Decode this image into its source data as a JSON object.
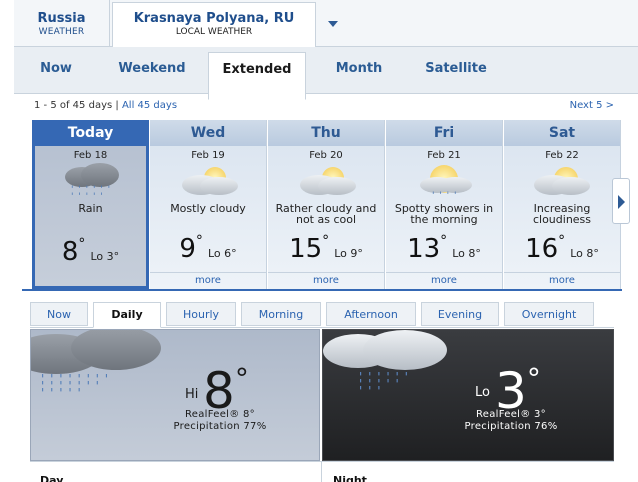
{
  "location": {
    "region_title": "Russia",
    "region_sub": "WEATHER",
    "current_title": "Krasnaya Polyana, RU",
    "current_sub": "LOCAL WEATHER"
  },
  "main_tabs": [
    "Now",
    "Weekend",
    "Extended",
    "Month",
    "Satellite"
  ],
  "range": {
    "text": "1 - 5 of 45 days",
    "separator": "|",
    "all_link": "All 45 days",
    "next_link": "Next 5 >"
  },
  "days": [
    {
      "name": "Today",
      "date": "Feb 18",
      "desc": "Rain",
      "hi": "8",
      "lo": "Lo 3°",
      "icon": "rain-cloud-icon"
    },
    {
      "name": "Wed",
      "date": "Feb 19",
      "desc": "Mostly cloudy",
      "hi": "9",
      "lo": "Lo 6°",
      "more": "more",
      "icon": "mostly-cloudy-icon"
    },
    {
      "name": "Thu",
      "date": "Feb 20",
      "desc": "Rather cloudy and not as cool",
      "hi": "15",
      "lo": "Lo 9°",
      "more": "more",
      "icon": "mostly-cloudy-icon"
    },
    {
      "name": "Fri",
      "date": "Feb 21",
      "desc": "Spotty showers in the morning",
      "hi": "13",
      "lo": "Lo 8°",
      "more": "more",
      "icon": "sun-shower-icon"
    },
    {
      "name": "Sat",
      "date": "Feb 22",
      "desc": "Increasing cloudiness",
      "hi": "16",
      "lo": "Lo 8°",
      "more": "more",
      "icon": "partly-cloudy-icon"
    }
  ],
  "sub_tabs": [
    "Now",
    "Daily",
    "Hourly",
    "Morning",
    "Afternoon",
    "Evening",
    "Overnight"
  ],
  "day_panel": {
    "prefix": "Hi",
    "temp": "8",
    "degree": "°",
    "realfeel": "RealFeel® 8°",
    "precip": "Precipitation 77%"
  },
  "night_panel": {
    "prefix": "Lo",
    "temp": "3",
    "degree": "°",
    "realfeel": "RealFeel® 3°",
    "precip": "Precipitation 76%"
  },
  "bottom_labels": {
    "day": "Day",
    "night": "Night"
  },
  "colors": {
    "accent": "#3568b4",
    "link": "#2b63b0"
  }
}
